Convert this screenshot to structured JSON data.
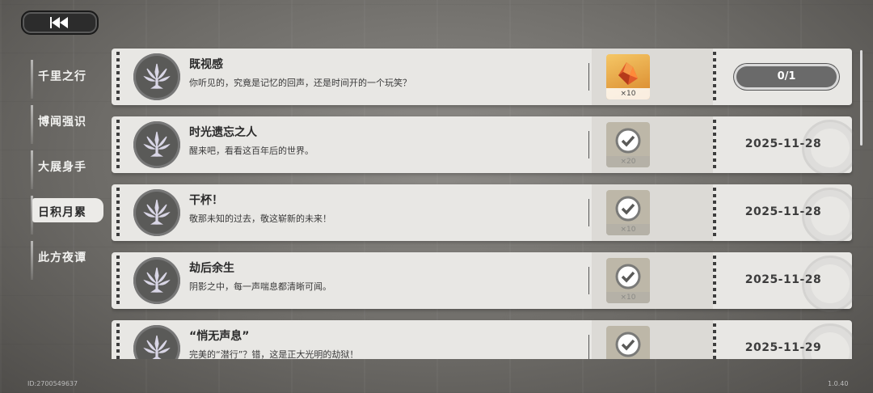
{
  "sidebar": {
    "items": [
      {
        "label": "千里之行"
      },
      {
        "label": "博闻强识"
      },
      {
        "label": "大展身手"
      },
      {
        "label": "日积月累",
        "active": true
      },
      {
        "label": "此方夜谭"
      }
    ]
  },
  "achievements": [
    {
      "title": "既视感",
      "desc": "你听见的，究竟是记忆的回声，还是时间开的一个玩笑？",
      "reward_qty": "×10",
      "reward_state": "unclaimed",
      "progress_text": "0/1",
      "progress_fraction": 0
    },
    {
      "title": "时光遗忘之人",
      "desc": "醒来吧，看看这百年后的世界。",
      "reward_qty": "×20",
      "reward_state": "claimed",
      "date": "2025-11-28"
    },
    {
      "title": "干杯！",
      "desc": "敬那未知的过去，敬这崭新的未来！",
      "reward_qty": "×10",
      "reward_state": "claimed",
      "date": "2025-11-28"
    },
    {
      "title": "劫后余生",
      "desc": "阴影之中，每一声喘息都清晰可闻。",
      "reward_qty": "×10",
      "reward_state": "claimed",
      "date": "2025-11-28"
    },
    {
      "title": "“悄无声息”",
      "desc": "完美的“潜行”？错，这是正大光明的劫狱！",
      "reward_qty": "",
      "reward_state": "claimed",
      "date": "2025-11-29"
    }
  ],
  "footer": {
    "id": "ID:2700549637",
    "version": "1.0.40"
  },
  "icons": {
    "back": "rewind-icon",
    "emblem": "flower-crest-icon",
    "reward": "crystal-icon",
    "claimed": "check-badge-icon"
  },
  "colors": {
    "card": "#e8e7e4",
    "active_tab": "#ecebe8",
    "reward_gold": "#f5c766"
  }
}
